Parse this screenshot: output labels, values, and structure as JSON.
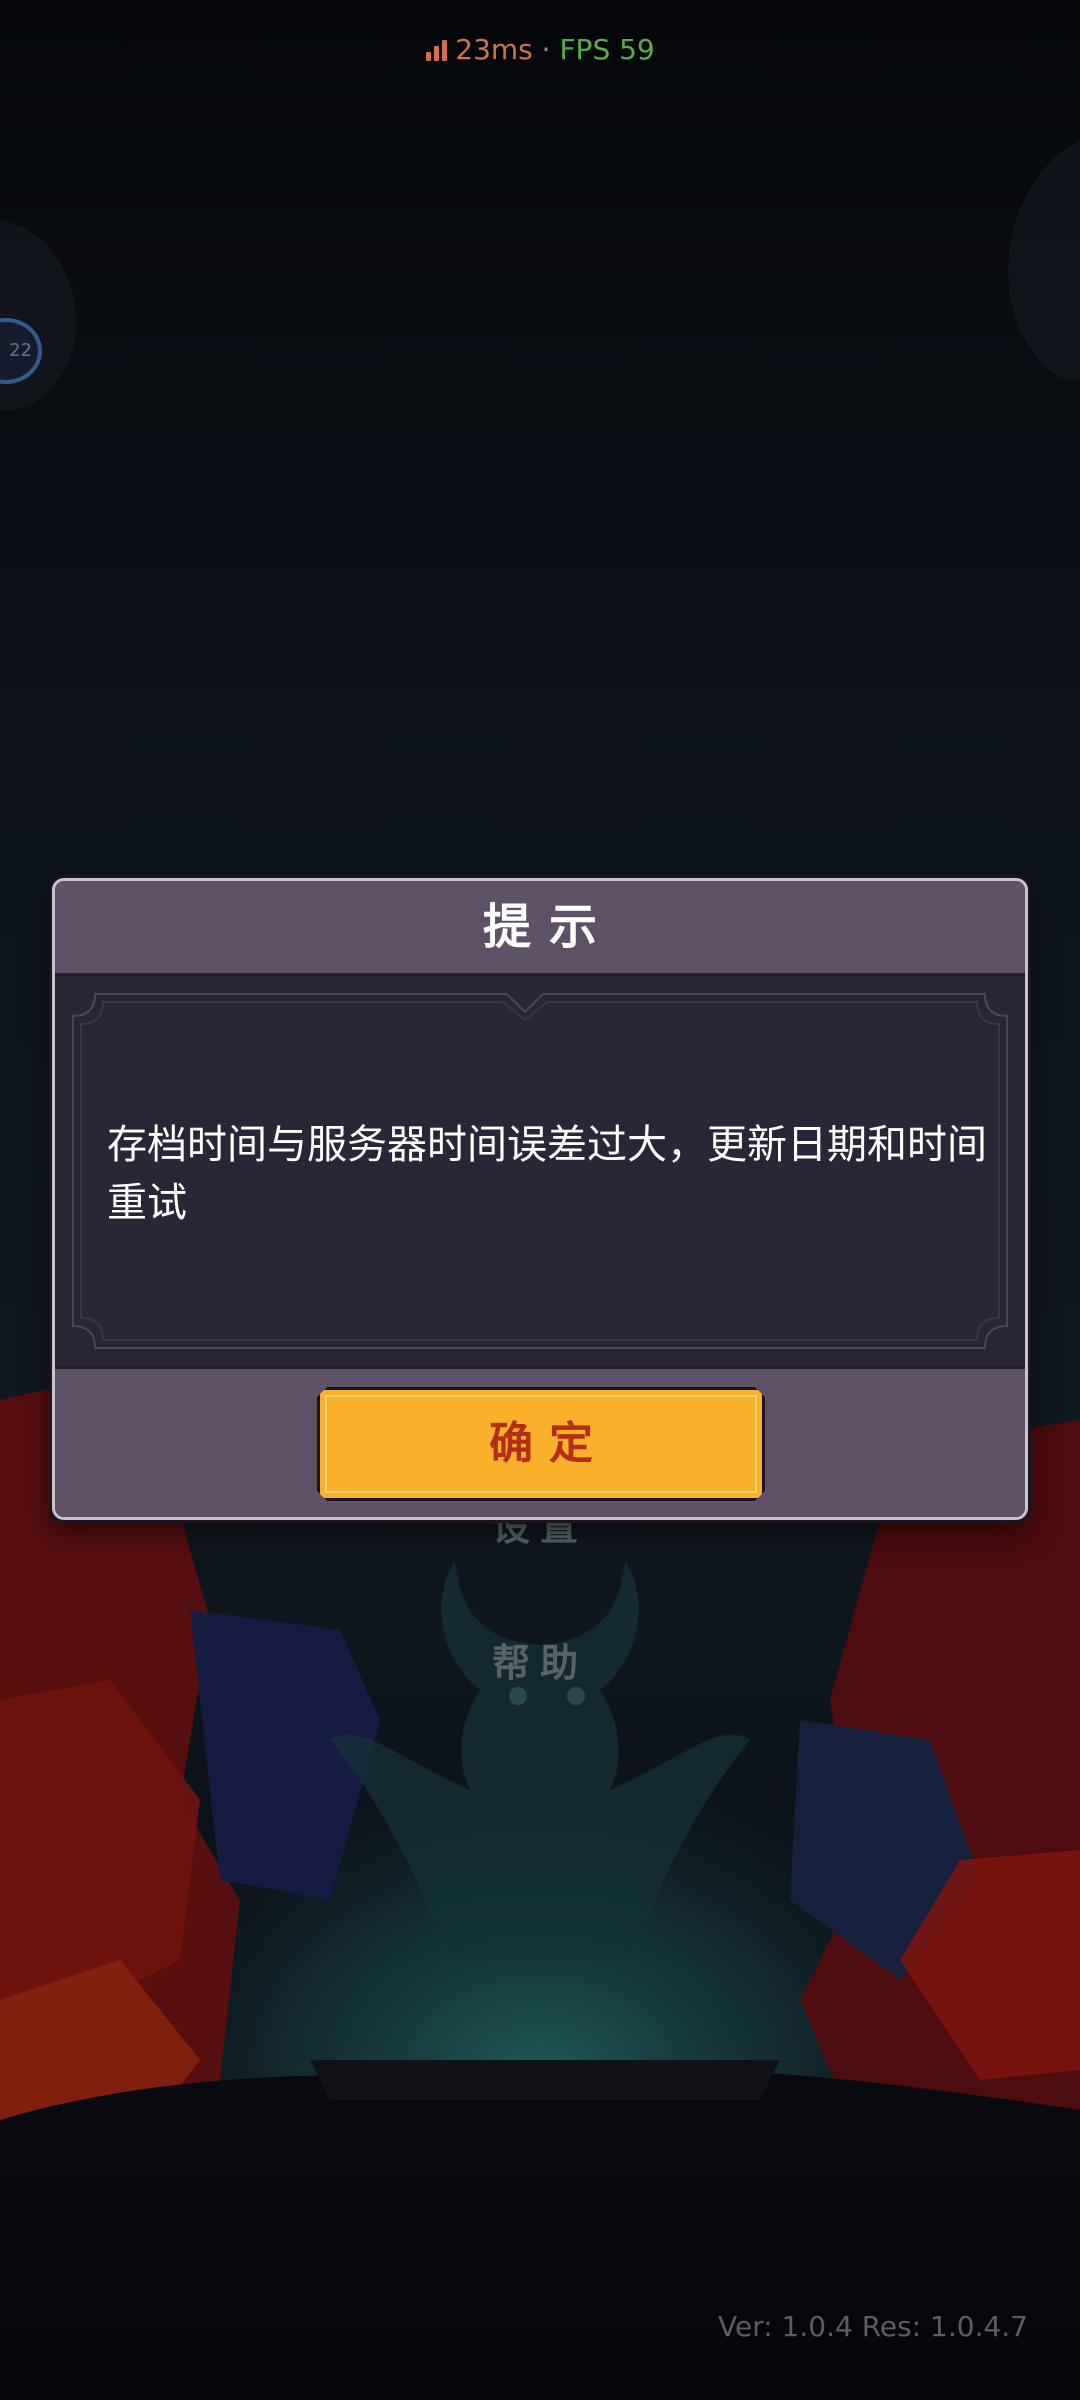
{
  "status_bar": {
    "ping": "23ms",
    "separator": " · ",
    "fps": "FPS 59",
    "ping_color": "#ff8a5c",
    "fps_color": "#6cd35a",
    "signal_icon": "signal-bars-icon"
  },
  "side_badge": {
    "text": "22"
  },
  "background_menu": {
    "items": [
      {
        "label": "设置"
      },
      {
        "label": "帮助"
      }
    ]
  },
  "dialog": {
    "title": "提示",
    "message": "存档时间与服务器时间误差过大，更新日期和时间重试",
    "confirm_label": "确定",
    "accent_color": "#fbb12b",
    "confirm_text_color": "#b52d12"
  },
  "footer": {
    "version": "Ver: 1.0.4 Res: 1.0.4.7"
  }
}
